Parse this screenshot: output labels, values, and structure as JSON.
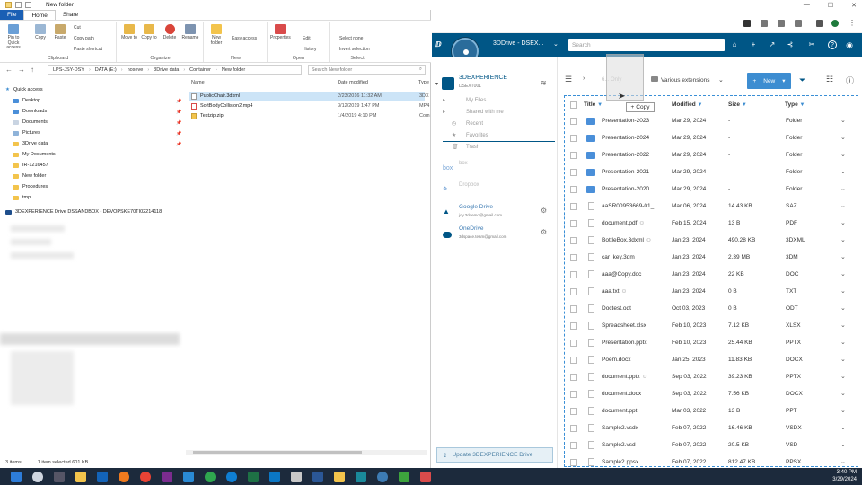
{
  "explorer": {
    "title": "New folder",
    "tabs": [
      "File",
      "Home",
      "Share"
    ],
    "ribbon": {
      "clipboard": {
        "label": "Clipboard",
        "pin": "Pin to Quick access",
        "copy": "Copy",
        "paste": "Paste",
        "cut": "Cut",
        "copy_path": "Copy path",
        "paste_shortcut": "Paste shortcut"
      },
      "organize": {
        "label": "Organize",
        "move_to": "Move to",
        "copy_to": "Copy to",
        "delete": "Delete",
        "rename": "Rename"
      },
      "new": {
        "label": "New",
        "new_folder": "New folder",
        "easy_access": "Easy access"
      },
      "open": {
        "label": "Open",
        "properties": "Properties",
        "edit": "Edit",
        "history": "History"
      },
      "select": {
        "label": "Select",
        "select_none": "Select none",
        "invert": "Invert selection"
      }
    },
    "path": [
      "LPS-JSY-DSY",
      "DATA (E:)",
      "noseve",
      "3Drive data",
      "Container",
      "New folder"
    ],
    "search_placeholder": "Search New folder",
    "nav": [
      {
        "label": "Quick access",
        "type": "star"
      },
      {
        "label": "Desktop",
        "type": "blue"
      },
      {
        "label": "Downloads",
        "type": "blue"
      },
      {
        "label": "Documents",
        "type": "plain"
      },
      {
        "label": "Pictures",
        "type": "plain"
      },
      {
        "label": "3Drive data",
        "type": "yellow"
      },
      {
        "label": "My Documents",
        "type": "yellow"
      },
      {
        "label": "IR-1216457",
        "type": "yellow"
      },
      {
        "label": "New folder",
        "type": "yellow"
      },
      {
        "label": "Procedures",
        "type": "yellow"
      },
      {
        "label": "tmp",
        "type": "yellow"
      }
    ],
    "drive_label": "3DEXPERIENCE Drive DSSANDBOX - DEVOPSKE70TI02214118",
    "columns": {
      "name": "Name",
      "date": "Date modified",
      "type": "Type"
    },
    "files": [
      {
        "name": "PublicChair.3dxml",
        "date": "2/23/2016 11:32 AM",
        "type": "3DX"
      },
      {
        "name": "SoftBodyCollision2.mp4",
        "date": "3/12/2019 1:47 PM",
        "type": "MP4"
      },
      {
        "name": "Testzip.zip",
        "date": "1/4/2019 4:10 PM",
        "type": "Com"
      }
    ],
    "status": {
      "items": "3 items",
      "selected": "1 item selected  601 KB"
    }
  },
  "dx": {
    "app_name": "3DDrive - DSEX...",
    "search_placeholder": "Search",
    "sidebar": {
      "brand": "3DEXPERIENCE",
      "tenant": "DSEXT001",
      "items": [
        "My Files",
        "Shared with me",
        "Recent",
        "Favorites",
        "Trash"
      ],
      "box": "box",
      "dropbox": "Dropbox",
      "google_drive": "Google Drive",
      "google_email": "joy.3ddemo@gmail.com",
      "onedrive": "OneDrive",
      "onedrive_email": "3dspace.team@gmail.com",
      "update_button": "Update 3DEXPERIENCE Drive"
    },
    "toolbar": {
      "breadcrumb": "6... Only",
      "filter": "Various extensions",
      "new_button": "New"
    },
    "drag_tooltip": "Copy",
    "columns": {
      "title": "Title",
      "modified": "Modified",
      "size": "Size",
      "type": "Type"
    },
    "rows": [
      {
        "name": "Presentation-2023",
        "modified": "Mar 29, 2024",
        "size": "-",
        "type": "Folder",
        "kind": "folder"
      },
      {
        "name": "Presentation-2024",
        "modified": "Mar 29, 2024",
        "size": "-",
        "type": "Folder",
        "kind": "folder"
      },
      {
        "name": "Presentation-2022",
        "modified": "Mar 29, 2024",
        "size": "-",
        "type": "Folder",
        "kind": "folder"
      },
      {
        "name": "Presentation-2021",
        "modified": "Mar 29, 2024",
        "size": "-",
        "type": "Folder",
        "kind": "folder"
      },
      {
        "name": "Presentation-2020",
        "modified": "Mar 29, 2024",
        "size": "-",
        "type": "Folder",
        "kind": "folder"
      },
      {
        "name": "aaSR00953669-01_...",
        "modified": "Mar 06, 2024",
        "size": "14.43 KB",
        "type": "SAZ",
        "kind": "file"
      },
      {
        "name": "document.pdf",
        "modified": "Feb 15, 2024",
        "size": "13 B",
        "type": "PDF",
        "kind": "file",
        "shared": true
      },
      {
        "name": "BottleBox.3dxml",
        "modified": "Jan 23, 2024",
        "size": "490.28 KB",
        "type": "3DXML",
        "kind": "file",
        "shared": true
      },
      {
        "name": "car_key.3dm",
        "modified": "Jan 23, 2024",
        "size": "2.39 MB",
        "type": "3DM",
        "kind": "file"
      },
      {
        "name": "aaa@Copy.doc",
        "modified": "Jan 23, 2024",
        "size": "22 KB",
        "type": "DOC",
        "kind": "file"
      },
      {
        "name": "aaa.txt",
        "modified": "Jan 23, 2024",
        "size": "0 B",
        "type": "TXT",
        "kind": "file",
        "shared": true
      },
      {
        "name": "Doctest.odt",
        "modified": "Oct 03, 2023",
        "size": "0 B",
        "type": "ODT",
        "kind": "file"
      },
      {
        "name": "Spreadsheet.xlsx",
        "modified": "Feb 10, 2023",
        "size": "7.12 KB",
        "type": "XLSX",
        "kind": "file"
      },
      {
        "name": "Presentation.pptx",
        "modified": "Feb 10, 2023",
        "size": "25.44 KB",
        "type": "PPTX",
        "kind": "file"
      },
      {
        "name": "Poem.docx",
        "modified": "Jan 25, 2023",
        "size": "11.83 KB",
        "type": "DOCX",
        "kind": "file"
      },
      {
        "name": "document.pptx",
        "modified": "Sep 03, 2022",
        "size": "39.23 KB",
        "type": "PPTX",
        "kind": "file",
        "shared": true
      },
      {
        "name": "document.docx",
        "modified": "Sep 03, 2022",
        "size": "7.56 KB",
        "type": "DOCX",
        "kind": "file"
      },
      {
        "name": "document.ppt",
        "modified": "Mar 03, 2022",
        "size": "13 B",
        "type": "PPT",
        "kind": "file"
      },
      {
        "name": "Sample2.vsdx",
        "modified": "Feb 07, 2022",
        "size": "16.46 KB",
        "type": "VSDX",
        "kind": "file"
      },
      {
        "name": "Sample2.vsd",
        "modified": "Feb 07, 2022",
        "size": "20.5 KB",
        "type": "VSD",
        "kind": "file"
      },
      {
        "name": "Sample2.ppsx",
        "modified": "Feb 07, 2022",
        "size": "812.47 KB",
        "type": "PPSX",
        "kind": "file"
      }
    ]
  },
  "taskbar": {
    "time": "3:40 PM",
    "date": "3/29/2024"
  }
}
